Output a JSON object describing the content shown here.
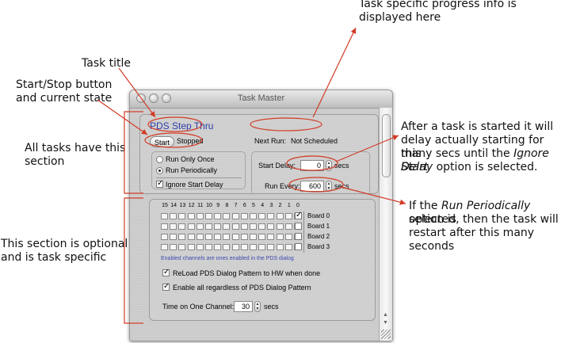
{
  "annotations": {
    "task_title": "Task title",
    "start_stop_1": "Start/Stop button",
    "start_stop_2": "and current state",
    "all_tasks_1": "All tasks have this",
    "all_tasks_2": "section",
    "optional_1": "This section is optional",
    "optional_2": "and is task specific",
    "progress_1": "Task specific progress info is",
    "progress_2": "displayed here",
    "delay_1": "After a task is started it will",
    "delay_2": "delay actually starting for this",
    "delay_3": "many secs until the",
    "delay_3_em": "Ignore Start",
    "delay_4_em": "Delay",
    "delay_4": "option is selected.",
    "periodic_1a": "If the",
    "periodic_1_em": "Run Periodically",
    "periodic_1b": "option is",
    "periodic_2": "selected, then the task will",
    "periodic_3": "restart after this many seconds"
  },
  "window": {
    "title": "Task Master",
    "task_title": "PDS Step Thru",
    "start_button": "Start",
    "state": "Stopped",
    "next_run_label": "Next Run:",
    "next_run_value": "Not Scheduled",
    "run_only_once": "Run Only Once",
    "run_periodically": "Run Periodically",
    "ignore_start_delay": "Ignore Start Delay",
    "start_delay_label": "Start Delay:",
    "start_delay_value": "0",
    "start_delay_unit": "secs",
    "run_every_label": "Run Every:",
    "run_every_value": "600",
    "run_every_unit": "secs",
    "selected_mode": "run_periodically",
    "ignore_start_delay_checked": true
  },
  "pds": {
    "channel_header": [
      "15",
      "14",
      "13",
      "12",
      "11",
      "10",
      "9",
      "8",
      "7",
      "6",
      "5",
      "4",
      "3",
      "2",
      "1",
      "0"
    ],
    "boards": [
      "Board 0",
      "Board 1",
      "Board 2",
      "Board 3"
    ],
    "board_checked": [
      true,
      false,
      false,
      false
    ],
    "hint": "Enabled channels are ones enabled in the PDS dialog",
    "reload_label": "ReLoad PDS Dialog Pattern to HW when done",
    "reload_checked": true,
    "enable_all_label": "Enable all regardless of PDS Dialog Pattern",
    "enable_all_checked": true,
    "time_label": "Time on One Channel:",
    "time_value": "30",
    "time_unit": "secs"
  },
  "colors": {
    "arrow": "#d23b25",
    "task_title": "#2f3ea8",
    "hint": "#3c4ab0"
  }
}
